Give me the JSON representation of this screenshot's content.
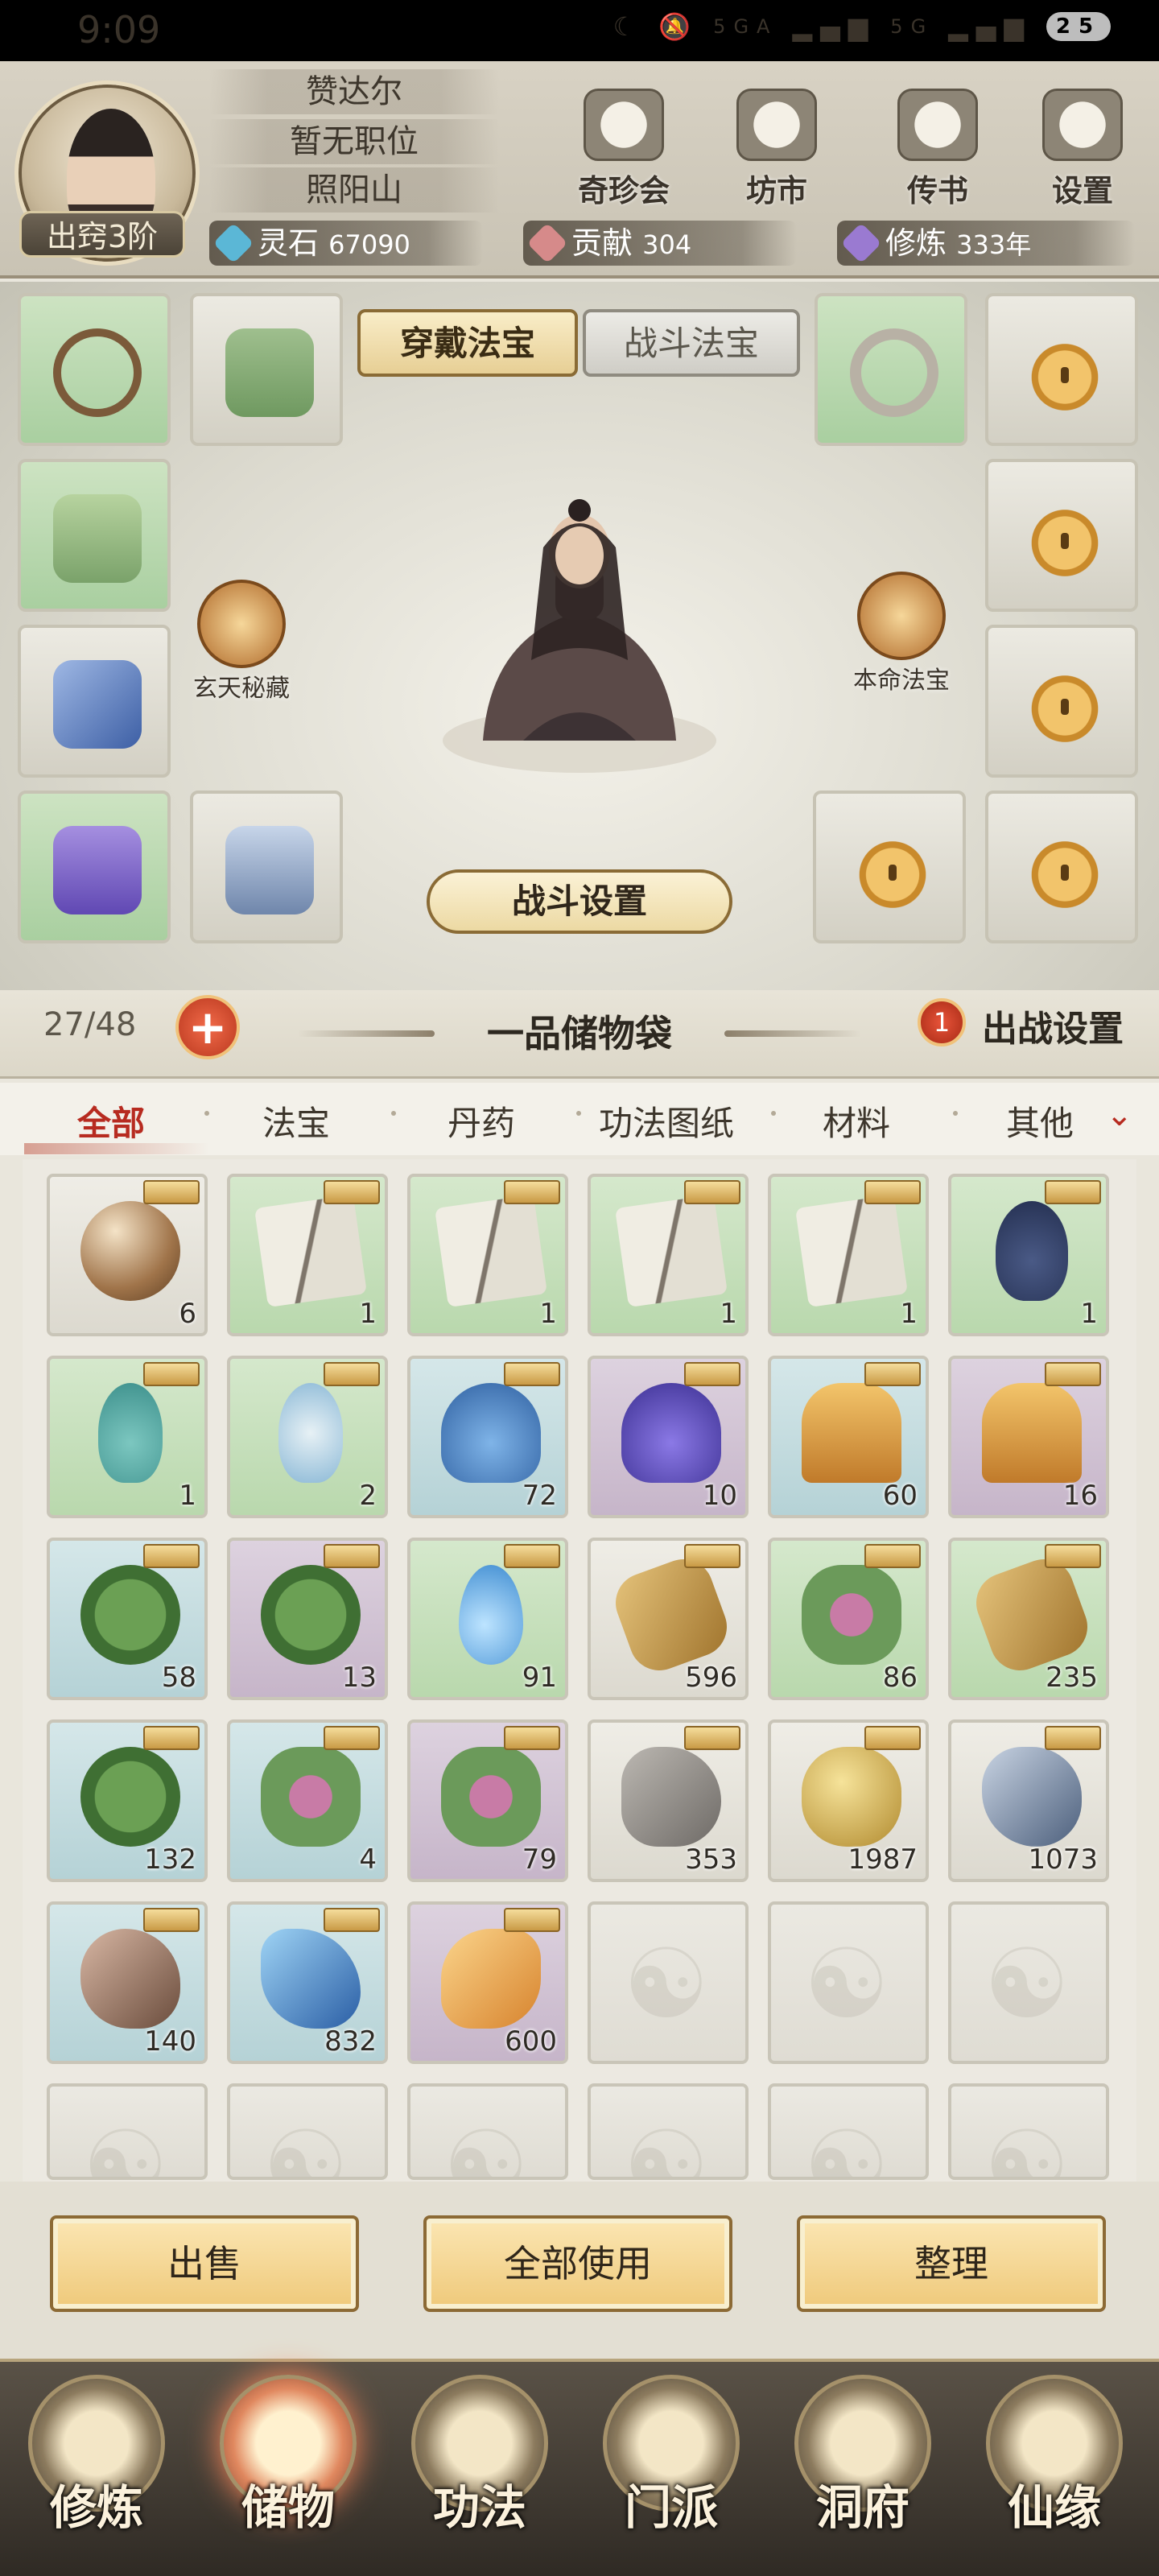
{
  "status_bar": {
    "time": "9:09",
    "network1": "5GA",
    "network2": "5G",
    "battery": "25"
  },
  "header": {
    "player_name": "赞达尔",
    "position": "暂无职位",
    "location": "照阳山",
    "rank": "出窍3阶",
    "buttons": [
      {
        "label": "奇珍会",
        "icon": "treasure-pavilion-icon"
      },
      {
        "label": "坊市",
        "icon": "market-icon"
      },
      {
        "label": "传书",
        "icon": "scroll-message-icon"
      },
      {
        "label": "设置",
        "icon": "gear-icon"
      }
    ],
    "resources": [
      {
        "label": "灵石",
        "value": "67090",
        "color": "#5bb7d6"
      },
      {
        "label": "贡献",
        "value": "304",
        "color": "#d68a8a"
      },
      {
        "label": "修炼",
        "value": "333年",
        "color": "#9a7ad1"
      }
    ]
  },
  "equipment": {
    "tab_wear": "穿戴法宝",
    "tab_battle": "战斗法宝",
    "secret_label": "玄天秘藏",
    "life_treasure_label": "本命法宝",
    "battle_settings": "战斗设置"
  },
  "bag": {
    "count": "27/48",
    "add": "+",
    "title": "一品储物袋",
    "deploy_count": "1",
    "deploy_label": "出战设置"
  },
  "filters": {
    "tabs": [
      "全部",
      "法宝",
      "丹药",
      "功法图纸",
      "材料",
      "其他"
    ],
    "active": "全部"
  },
  "items": [
    {
      "rarity": "gray",
      "shape": "orb",
      "qty": "6"
    },
    {
      "rarity": "green",
      "shape": "book",
      "qty": "1"
    },
    {
      "rarity": "green",
      "shape": "book",
      "qty": "1"
    },
    {
      "rarity": "green",
      "shape": "book",
      "qty": "1"
    },
    {
      "rarity": "green",
      "shape": "book",
      "qty": "1"
    },
    {
      "rarity": "green",
      "shape": "vase",
      "qty": "1"
    },
    {
      "rarity": "green",
      "shape": "vase2",
      "qty": "1"
    },
    {
      "rarity": "green",
      "shape": "vase3",
      "qty": "2"
    },
    {
      "rarity": "blue",
      "shape": "flower-b",
      "qty": "72"
    },
    {
      "rarity": "purple",
      "shape": "flower-p",
      "qty": "10"
    },
    {
      "rarity": "blue",
      "shape": "grass",
      "qty": "60"
    },
    {
      "rarity": "purple",
      "shape": "grass",
      "qty": "16"
    },
    {
      "rarity": "blue",
      "shape": "leaf",
      "qty": "58"
    },
    {
      "rarity": "purple",
      "shape": "leaf",
      "qty": "13"
    },
    {
      "rarity": "green",
      "shape": "drop",
      "qty": "91"
    },
    {
      "rarity": "gray",
      "shape": "root",
      "qty": "596"
    },
    {
      "rarity": "green",
      "shape": "herb",
      "qty": "86"
    },
    {
      "rarity": "green",
      "shape": "root",
      "qty": "235"
    },
    {
      "rarity": "blue",
      "shape": "leaf",
      "qty": "132"
    },
    {
      "rarity": "blue",
      "shape": "herb",
      "qty": "4"
    },
    {
      "rarity": "purple",
      "shape": "herb",
      "qty": "79"
    },
    {
      "rarity": "gray",
      "shape": "stone-g",
      "qty": "353"
    },
    {
      "rarity": "gray",
      "shape": "stone-y",
      "qty": "1987"
    },
    {
      "rarity": "gray",
      "shape": "stone-s",
      "qty": "1073"
    },
    {
      "rarity": "blue",
      "shape": "stone-r",
      "qty": "140"
    },
    {
      "rarity": "blue",
      "shape": "crystal",
      "qty": "832"
    },
    {
      "rarity": "purple",
      "shape": "amber",
      "qty": "600"
    }
  ],
  "actions": {
    "sell": "出售",
    "use_all": "全部使用",
    "sort": "整理"
  },
  "nav": [
    {
      "label": "修炼",
      "icon": "cultivate-icon"
    },
    {
      "label": "储物",
      "icon": "storage-bag-icon"
    },
    {
      "label": "功法",
      "icon": "manual-icon"
    },
    {
      "label": "门派",
      "icon": "sect-icon"
    },
    {
      "label": "洞府",
      "icon": "cave-icon"
    },
    {
      "label": "仙缘",
      "icon": "destiny-icon"
    }
  ],
  "nav_active": "储物"
}
